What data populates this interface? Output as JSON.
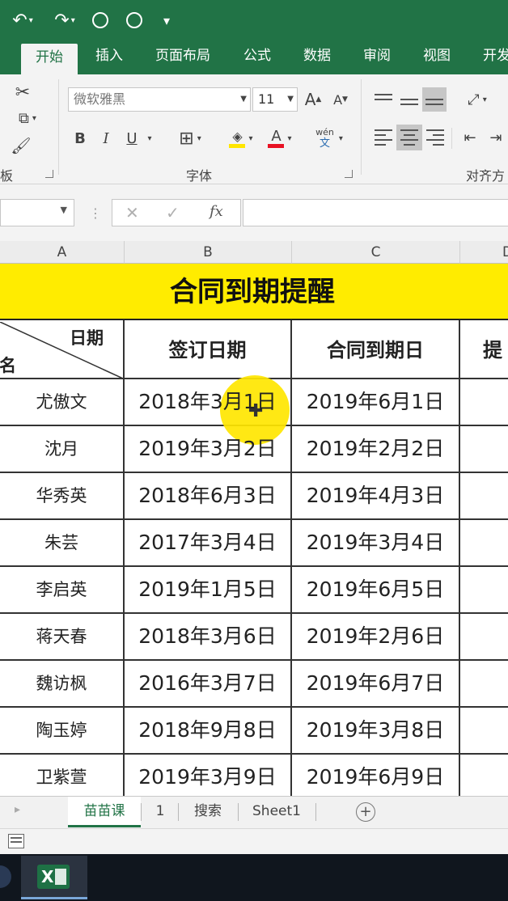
{
  "quick_access": {
    "more_label": "▾"
  },
  "ribbon_tabs": [
    {
      "label": "开始"
    },
    {
      "label": "插入"
    },
    {
      "label": "页面布局"
    },
    {
      "label": "公式"
    },
    {
      "label": "数据"
    },
    {
      "label": "审阅"
    },
    {
      "label": "视图"
    },
    {
      "label": "开发"
    }
  ],
  "ribbon": {
    "clipboard_label": "板",
    "font_name": "微软雅黑",
    "font_size": "11",
    "font_group_label": "字体",
    "align_group_label": "对齐方",
    "bold": "B",
    "italic": "I",
    "underline": "U",
    "phonetic": "wén",
    "phonetic_sub": "文",
    "grow_font": "A",
    "shrink_font": "A"
  },
  "formula_bar": {
    "fx_label": "fx",
    "cancel": "✕",
    "enter": "✓"
  },
  "columns": [
    "A",
    "B",
    "C",
    "D"
  ],
  "sheet": {
    "title": "合同到期提醒",
    "corner_top": "日期",
    "corner_bottom": "姓名",
    "headers": [
      "签订日期",
      "合同到期日",
      "提"
    ],
    "rows": [
      {
        "name": "尤傲文",
        "sign": "2018年3月1日",
        "due": "2019年6月1日"
      },
      {
        "name": "沈月",
        "sign": "2019年3月2日",
        "due": "2019年2月2日"
      },
      {
        "name": "华秀英",
        "sign": "2018年6月3日",
        "due": "2019年4月3日"
      },
      {
        "name": "朱芸",
        "sign": "2017年3月4日",
        "due": "2019年3月4日"
      },
      {
        "name": "李启英",
        "sign": "2019年1月5日",
        "due": "2019年6月5日"
      },
      {
        "name": "蒋天春",
        "sign": "2018年3月6日",
        "due": "2019年2月6日"
      },
      {
        "name": "魏访枫",
        "sign": "2016年3月7日",
        "due": "2019年6月7日"
      },
      {
        "name": "陶玉婷",
        "sign": "2018年9月8日",
        "due": "2019年3月8日"
      },
      {
        "name": "卫紫萱",
        "sign": "2019年3月9日",
        "due": "2019年6月9日"
      }
    ]
  },
  "sheet_tabs": [
    {
      "label": "苗苗课"
    },
    {
      "label": "1"
    },
    {
      "label": "搜索"
    },
    {
      "label": "Sheet1"
    }
  ],
  "add_sheet": "+",
  "colors": {
    "excel_green": "#217346",
    "title_yellow": "#ffec00",
    "cursor_highlight": "#ffe600"
  },
  "taskbar": {
    "app_icon": "excel-icon",
    "app_letter": "X"
  }
}
